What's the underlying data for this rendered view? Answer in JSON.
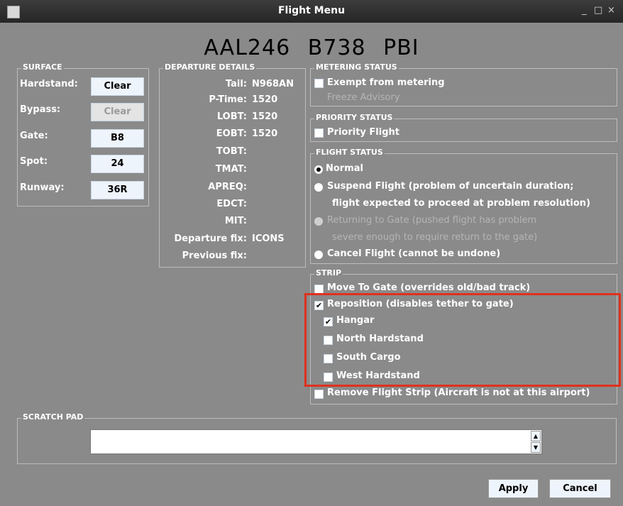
{
  "window": {
    "title": "Flight Menu",
    "controls": [
      "_",
      "□",
      "×"
    ]
  },
  "header": {
    "callsign": "AAL246",
    "aircraft": "B738",
    "destination": "PBI"
  },
  "surface": {
    "title": "SURFACE",
    "rows": [
      {
        "label": "Hardstand:",
        "value": "Clear",
        "disabled": false
      },
      {
        "label": "Bypass:",
        "value": "Clear",
        "disabled": true
      },
      {
        "label": "Gate:",
        "value": "B8",
        "disabled": false
      },
      {
        "label": "Spot:",
        "value": "24",
        "disabled": false
      },
      {
        "label": "Runway:",
        "value": "36R",
        "disabled": false
      }
    ]
  },
  "departure": {
    "title": "DEPARTURE DETAILS",
    "rows": [
      {
        "label": "Tail:",
        "value": "N968AN"
      },
      {
        "label": "P-Time:",
        "value": "1520"
      },
      {
        "label": "LOBT:",
        "value": "1520"
      },
      {
        "label": "EOBT:",
        "value": "1520"
      },
      {
        "label": "TOBT:",
        "value": ""
      },
      {
        "label": "TMAT:",
        "value": ""
      },
      {
        "label": "APREQ:",
        "value": ""
      },
      {
        "label": "EDCT:",
        "value": ""
      },
      {
        "label": "MIT:",
        "value": ""
      },
      {
        "label": "Departure fix:",
        "value": "ICONS"
      },
      {
        "label": "Previous fix:",
        "value": ""
      }
    ]
  },
  "metering": {
    "title": "METERING STATUS",
    "exempt_label": "Exempt from metering",
    "exempt_checked": false,
    "freeze_label": "Freeze Advisory"
  },
  "priority": {
    "title": "PRIORITY STATUS",
    "label": "Priority Flight",
    "checked": false
  },
  "flight_status": {
    "title": "FLIGHT STATUS",
    "options": [
      {
        "label": "Normal",
        "selected": true,
        "disabled": false
      },
      {
        "label": "Suspend Flight (problem of uncertain duration;",
        "label2": "flight expected to proceed at problem resolution)",
        "selected": false,
        "disabled": false
      },
      {
        "label": "Returning to Gate (pushed flight has problem",
        "label2": "severe enough to require return to the gate)",
        "selected": false,
        "disabled": true
      },
      {
        "label": "Cancel Flight (cannot be undone)",
        "selected": false,
        "disabled": false
      }
    ]
  },
  "strip": {
    "title": "STRIP",
    "move_to_gate": {
      "label": "Move To Gate (overrides old/bad track)",
      "checked": false
    },
    "reposition": {
      "label": "Reposition (disables tether to gate)",
      "checked": true
    },
    "locations": [
      {
        "label": "Hangar",
        "checked": true
      },
      {
        "label": "North Hardstand",
        "checked": false
      },
      {
        "label": "South Cargo",
        "checked": false
      },
      {
        "label": "West Hardstand",
        "checked": false
      }
    ],
    "remove": {
      "label": "Remove Flight Strip (Aircraft is not at this airport)",
      "checked": false
    }
  },
  "scratch_pad": {
    "title": "SCRATCH PAD",
    "value": ""
  },
  "actions": {
    "apply": "Apply",
    "cancel": "Cancel"
  },
  "colors": {
    "window_bg": "#8a8a8a",
    "titlebar": "#2e2e2e",
    "highlight": "#e0301e",
    "button_bg": "#eef4fb"
  }
}
